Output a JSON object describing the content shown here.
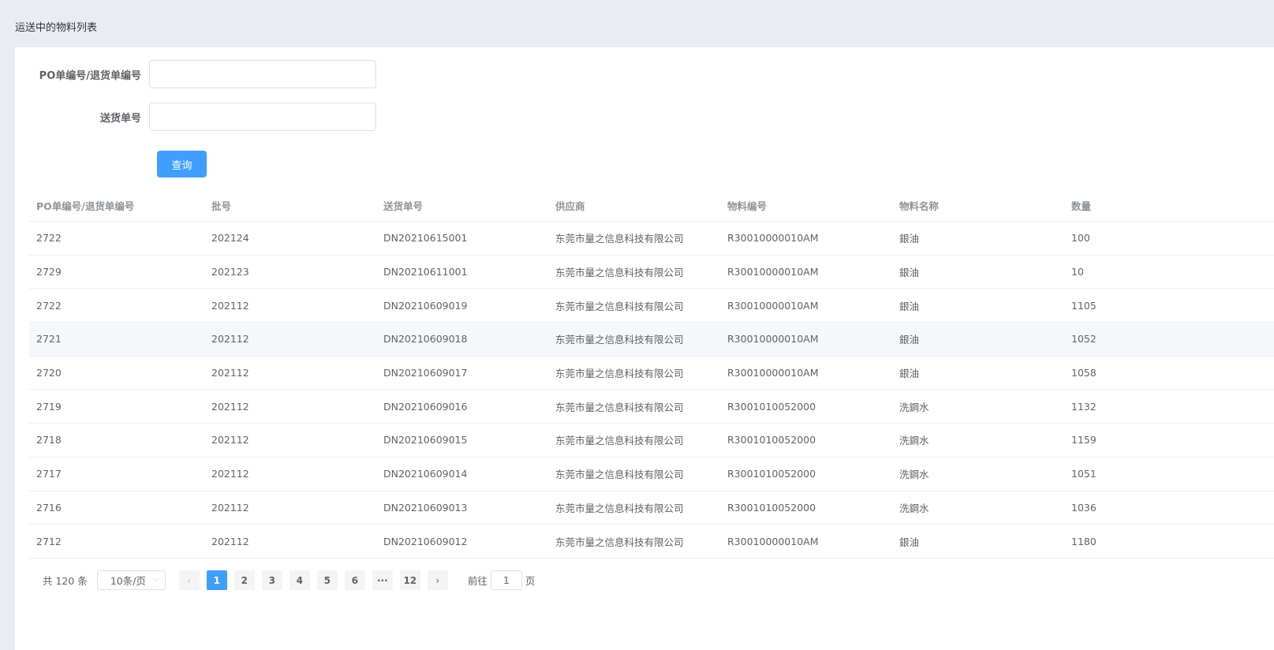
{
  "page": {
    "title": "运送中的物料列表"
  },
  "form": {
    "po_label": "PO单编号/退货单编号",
    "po_value": "",
    "delivery_label": "送货单号",
    "delivery_value": "",
    "query_label": "查询"
  },
  "table": {
    "headers": [
      "PO单编号/退货单编号",
      "批号",
      "送货单号",
      "供应商",
      "物料编号",
      "物料名称",
      "数量"
    ],
    "rows": [
      [
        "2722",
        "202124",
        "DN20210615001",
        "东莞市量之信息科技有限公司",
        "R30010000010AM",
        "銀油",
        "100"
      ],
      [
        "2729",
        "202123",
        "DN20210611001",
        "东莞市量之信息科技有限公司",
        "R30010000010AM",
        "銀油",
        "10"
      ],
      [
        "2722",
        "202112",
        "DN20210609019",
        "东莞市量之信息科技有限公司",
        "R30010000010AM",
        "銀油",
        "1105"
      ],
      [
        "2721",
        "202112",
        "DN20210609018",
        "东莞市量之信息科技有限公司",
        "R30010000010AM",
        "銀油",
        "1052"
      ],
      [
        "2720",
        "202112",
        "DN20210609017",
        "东莞市量之信息科技有限公司",
        "R30010000010AM",
        "銀油",
        "1058"
      ],
      [
        "2719",
        "202112",
        "DN20210609016",
        "东莞市量之信息科技有限公司",
        "R3001010052000",
        "洗鋼水",
        "1132"
      ],
      [
        "2718",
        "202112",
        "DN20210609015",
        "东莞市量之信息科技有限公司",
        "R3001010052000",
        "洗鋼水",
        "1159"
      ],
      [
        "2717",
        "202112",
        "DN20210609014",
        "东莞市量之信息科技有限公司",
        "R3001010052000",
        "洗鋼水",
        "1051"
      ],
      [
        "2716",
        "202112",
        "DN20210609013",
        "东莞市量之信息科技有限公司",
        "R3001010052000",
        "洗鋼水",
        "1036"
      ],
      [
        "2712",
        "202112",
        "DN20210609012",
        "东莞市量之信息科技有限公司",
        "R30010000010AM",
        "銀油",
        "1180"
      ]
    ],
    "hover_row_index": 3
  },
  "pagination": {
    "total_text": "共 120 条",
    "page_size": "10条/页",
    "pages": [
      "1",
      "2",
      "3",
      "4",
      "5",
      "6",
      "···",
      "12"
    ],
    "current_page": "1",
    "goto_prefix": "前往",
    "goto_value": "1",
    "goto_suffix": "页"
  },
  "colors": {
    "accent": "#409eff",
    "background": "#e9ecf3",
    "border": "#ebeef5",
    "hover": "#f5f7fa"
  },
  "icons": {
    "prev": "chevron-left-icon",
    "next": "chevron-right-icon",
    "select": "chevron-down-icon"
  }
}
